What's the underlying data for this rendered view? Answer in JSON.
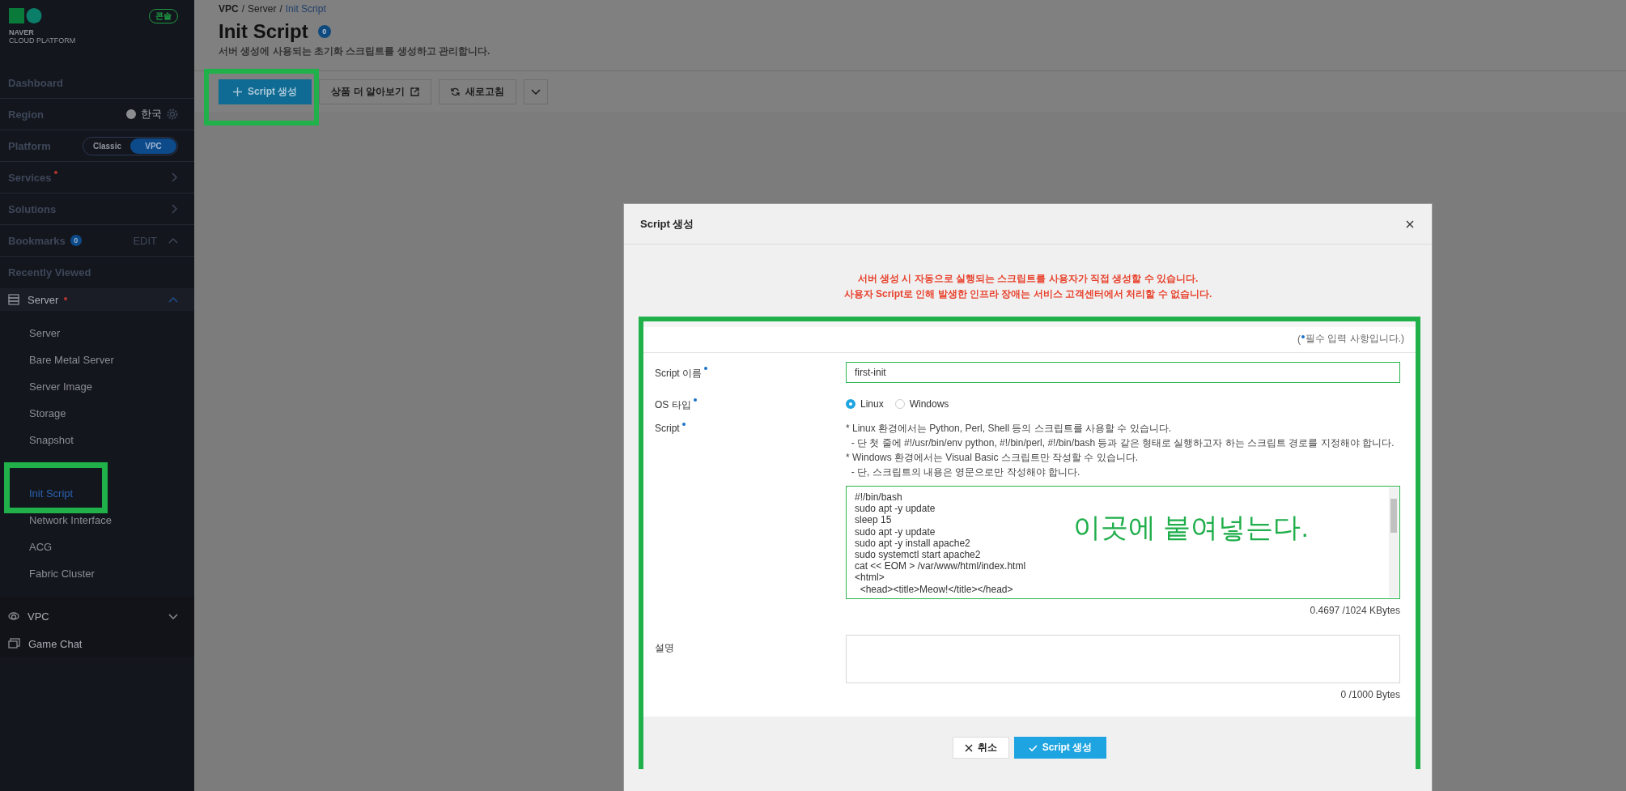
{
  "sidebar": {
    "logo": {
      "line1": "NAVER",
      "line2": "CLOUD PLATFORM"
    },
    "console_badge": "콘솔",
    "rows": [
      {
        "kind": "link",
        "label": "Dashboard"
      },
      {
        "kind": "region",
        "label": "Region",
        "value": "한국"
      },
      {
        "kind": "platform",
        "label": "Platform",
        "options": [
          {
            "label": "Classic",
            "selected": false
          },
          {
            "label": "VPC",
            "selected": true
          }
        ]
      },
      {
        "kind": "nav",
        "label": "Services",
        "dot": true
      },
      {
        "kind": "nav",
        "label": "Solutions"
      },
      {
        "kind": "bookmarks",
        "label": "Bookmarks",
        "count": "0",
        "action": "EDIT",
        "expanded": true
      },
      {
        "kind": "heading",
        "label": "Recently Viewed"
      }
    ],
    "groups": [
      {
        "kind": "server",
        "label": "Server",
        "dot": true,
        "expanded": true,
        "children": [
          {
            "label": "Server",
            "selected": false,
            "highlighted": false
          },
          {
            "label": "Bare Metal Server",
            "selected": false,
            "highlighted": false
          },
          {
            "label": "Server Image",
            "selected": false,
            "highlighted": false
          },
          {
            "label": "Storage",
            "selected": false,
            "highlighted": false
          },
          {
            "label": "Snapshot",
            "selected": false,
            "highlighted": false
          },
          {
            "label": "Init Script",
            "selected": true,
            "highlighted": true
          },
          {
            "label": "Network Interface",
            "selected": false,
            "highlighted": false
          },
          {
            "label": "ACG",
            "selected": false,
            "highlighted": false
          },
          {
            "label": "Fabric Cluster",
            "selected": false,
            "highlighted": false
          }
        ]
      },
      {
        "kind": "vpc",
        "label": "VPC",
        "expanded": false
      },
      {
        "kind": "chat",
        "label": "Game Chat"
      }
    ]
  },
  "header": {
    "breadcrumb": [
      {
        "label": "VPC",
        "separator": "/",
        "selected": false
      },
      {
        "label": "Server",
        "separator": "/",
        "selected": false
      },
      {
        "label": "Init Script",
        "selected": true
      }
    ],
    "title": "Init Script",
    "count": "0",
    "subtitle": "서버 생성에 사용되는 초기화 스크립트를 생성하고 관리합니다.",
    "toolbar": [
      {
        "kind": "primary",
        "label": "Script 생성",
        "highlighted": true
      },
      {
        "kind": "external",
        "label": "상품 더 알아보기",
        "highlighted": false
      },
      {
        "kind": "refresh",
        "label": "새로고침",
        "highlighted": false
      },
      {
        "kind": "menu"
      }
    ]
  },
  "modal": {
    "title": "Script 생성",
    "warnings": [
      "서버 생성 시 자동으로 실행되는 스크립트를 사용자가 직접 생성할 수 있습니다.",
      "사용자 Script로 인해 발생한 인프라 장애는 서비스 고객센터에서 처리할 수 없습니다."
    ],
    "highlighted": true,
    "required_note": {
      "open": "(",
      "text": "필수 입력 사항입니다.)"
    },
    "fields": [
      {
        "kind": "text",
        "label": "Script 이름",
        "required": true,
        "value": "first-init"
      },
      {
        "kind": "radio",
        "label": "OS 타입",
        "required": true,
        "options": [
          {
            "label": "Linux",
            "selected": true
          },
          {
            "label": "Windows",
            "selected": false
          }
        ]
      },
      {
        "kind": "script",
        "label": "Script",
        "required": true,
        "help": [
          "* Linux 환경에서는 Python, Perl, Shell 등의 스크립트를 사용할 수 있습니다.",
          "  - 단 첫 줄에 #!/usr/bin/env python, #!/bin/perl, #!/bin/bash 등과 같은 형태로 실행하고자 하는 스크립트 경로를 지정해야 합니다.",
          "* Windows 환경에서는 Visual Basic 스크립트만 작성할 수 있습니다.",
          "  - 단, 스크립트의 내용은 영문으로만 작성해야 합니다."
        ],
        "value": "#!/bin/bash\nsudo apt -y update\nsleep 15\nsudo apt -y update\nsudo apt -y install apache2\nsudo systemctl start apache2\ncat << EOM > /var/www/html/index.html\n<html>\n  <head><title>Meow!</title></head>",
        "annotation": "이곳에 붙여넣는다.",
        "counter": "0.4697 /1024 KBytes"
      },
      {
        "kind": "textarea",
        "label": "설명",
        "required": false,
        "counter": "0 /1000 Bytes"
      }
    ],
    "buttons": [
      {
        "kind": "cancel",
        "label": "취소"
      },
      {
        "kind": "submit",
        "label": "Script 생성"
      }
    ]
  }
}
